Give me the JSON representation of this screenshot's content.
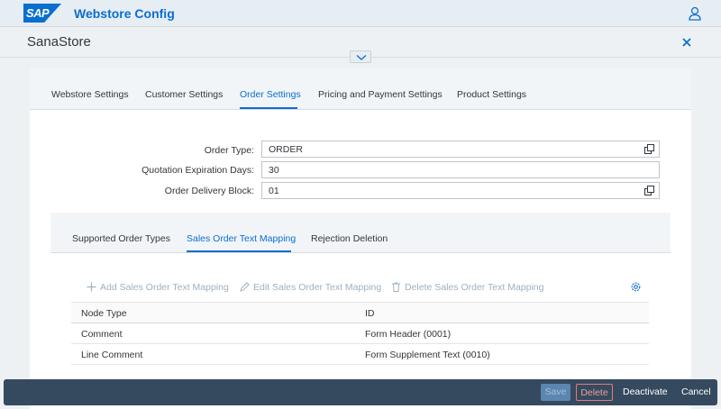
{
  "shell": {
    "logo_text": "SAP",
    "title": "Webstore Config"
  },
  "header": {
    "object_title": "SanaStore"
  },
  "tabs": [
    {
      "label": "Webstore Settings"
    },
    {
      "label": "Customer Settings"
    },
    {
      "label": "Order Settings"
    },
    {
      "label": "Pricing and Payment Settings"
    },
    {
      "label": "Product Settings"
    }
  ],
  "form": {
    "order_type": {
      "label": "Order Type:",
      "value": "ORDER"
    },
    "quotation_days": {
      "label": "Quotation Expiration Days:",
      "value": "30"
    },
    "delivery_block": {
      "label": "Order Delivery Block:",
      "value": "01"
    }
  },
  "subtabs": [
    {
      "label": "Supported Order Types"
    },
    {
      "label": "Sales Order Text Mapping"
    },
    {
      "label": "Rejection Deletion"
    }
  ],
  "toolbar": {
    "add": "Add Sales Order Text Mapping",
    "edit": "Edit Sales Order Text Mapping",
    "delete": "Delete Sales Order Text Mapping"
  },
  "table": {
    "columns": [
      "Node Type",
      "ID"
    ],
    "rows": [
      [
        "Comment",
        "Form Header (0001)"
      ],
      [
        "Line Comment",
        "Form Supplement Text (0010)"
      ]
    ]
  },
  "footer": {
    "save": "Save",
    "delete": "Delete",
    "deactivate": "Deactivate",
    "cancel": "Cancel"
  },
  "colors": {
    "accent": "#0a6ed1",
    "footer_bg": "#354a5f"
  }
}
